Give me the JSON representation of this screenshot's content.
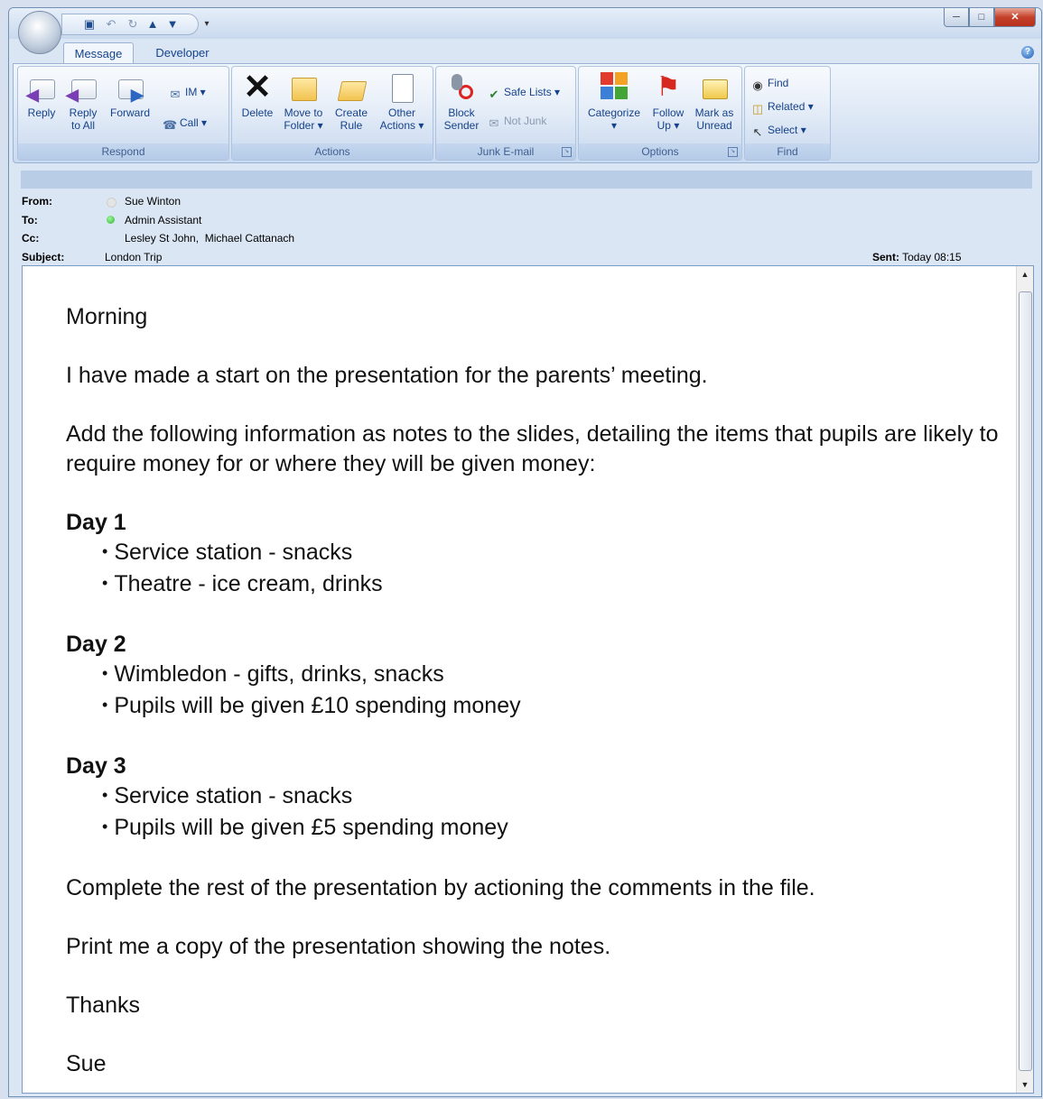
{
  "tabs": [
    "Message",
    "Developer"
  ],
  "ribbon": {
    "respond": {
      "label": "Respond",
      "reply": "Reply",
      "reply_all_1": "Reply",
      "reply_all_2": "to All",
      "forward": "Forward",
      "im": "IM",
      "call": "Call"
    },
    "actions": {
      "label": "Actions",
      "delete": "Delete",
      "move_1": "Move to",
      "move_2": "Folder",
      "create_1": "Create",
      "create_2": "Rule",
      "other_1": "Other",
      "other_2": "Actions"
    },
    "junk": {
      "label": "Junk E-mail",
      "safe_lists": "Safe Lists",
      "block_1": "Block",
      "block_2": "Sender",
      "not_junk": "Not Junk"
    },
    "options": {
      "label": "Options",
      "categorize": "Categorize",
      "follow_1": "Follow",
      "follow_2": "Up",
      "mark_1": "Mark as",
      "mark_2": "Unread"
    },
    "find": {
      "label": "Find",
      "find": "Find",
      "related": "Related",
      "select": "Select"
    }
  },
  "header": {
    "from_label": "From:",
    "from": "Sue Winton",
    "to_label": "To:",
    "to": "Admin Assistant",
    "cc_label": "Cc:",
    "cc": "Lesley St John,  Michael Cattanach",
    "subject_label": "Subject:",
    "subject": "London Trip",
    "sent_label": "Sent:",
    "sent": "Today 08:15"
  },
  "body": {
    "greeting": "Morning",
    "p1": "I have made a start on the presentation for the parents’ meeting.",
    "p2": "Add the following information as notes to the slides, detailing the items that pupils are likely to require money for or where they will be given money:",
    "days": [
      {
        "title": "Day 1",
        "items": [
          "Service station - snacks",
          "Theatre - ice cream, drinks"
        ]
      },
      {
        "title": "Day 2",
        "items": [
          "Wimbledon - gifts, drinks, snacks",
          "Pupils will be given £10 spending money"
        ]
      },
      {
        "title": "Day 3",
        "items": [
          "Service station - snacks",
          "Pupils will be given £5 spending money"
        ]
      }
    ],
    "p3": "Complete the rest of the presentation by actioning the comments in the file.",
    "p4": "Print me a copy of the presentation showing the notes.",
    "thanks": "Thanks",
    "signoff": "Sue"
  },
  "colors": {
    "online": "#2fb52f",
    "offline": "#d8d8d8"
  }
}
